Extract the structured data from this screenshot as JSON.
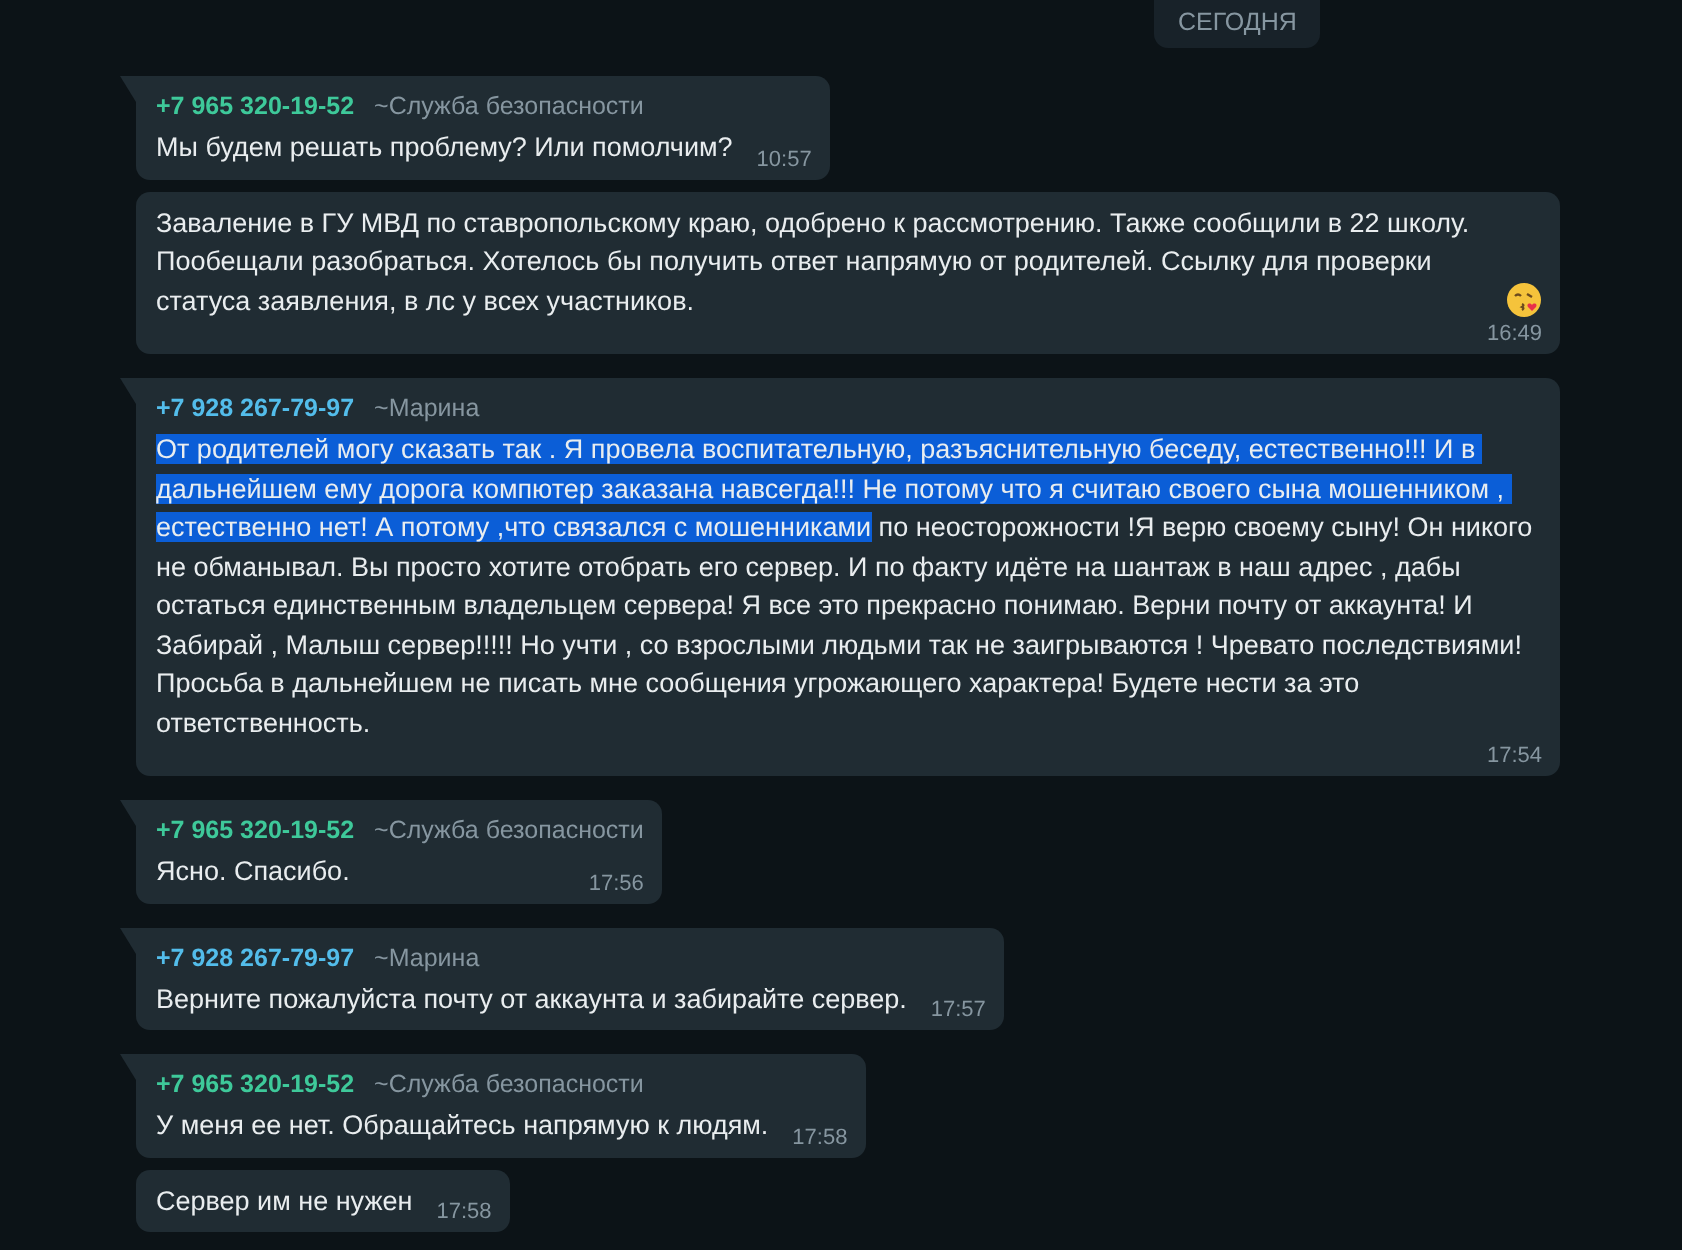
{
  "date_label": "СЕГОДНЯ",
  "messages": [
    {
      "tail": true,
      "sender": {
        "phone": "+7 965 320-19-52",
        "name": "~Служба безопасности",
        "color": "#3ec99a"
      },
      "segments": [
        {
          "text": "Мы будем решать проблему? Или помолчим?",
          "selected": false
        }
      ],
      "time": "10:57"
    },
    {
      "tail": false,
      "segments": [
        {
          "text": "Заваление в ГУ МВД по ставропольскому краю, одобрено к рассмотрению. Также сообщили в 22 школу. Пообещали разобраться. Хотелось бы получить ответ напрямую от родителей. Ссылку для проверки статуса заявления, в лс у всех участников. ",
          "selected": false
        }
      ],
      "emoji": true,
      "time": "16:49"
    },
    {
      "tail": true,
      "sender": {
        "phone": "+7 928 267-79-97",
        "name": "~Марина",
        "color": "#53bdeb"
      },
      "segments": [
        {
          "text": "От родителей могу сказать так . Я провела воспитательную, разъяснительную беседу, естественно!!! И в дальнейшем ему дорога компютер заказана навсегда!!! Не потому что я считаю своего сына мошенником , естественно нет! А потому ,что связался с мошенниками",
          "selected": true
        },
        {
          "text": " по неосторожности !Я верю своему сыну! Он никого не обманывал. Вы просто хотите отобрать его сервер. И по факту идёте на шантаж в наш адрес , дабы остаться единственным владельцем сервера! Я все это прекрасно понимаю. Верни почту от аккаунта! И  Забирай , Малыш сервер!!!!! Но учти , со взрослыми людьми так не заигрываются ! Чревато последствиями!\nПросьба в дальнейшем не писать мне сообщения угрожающего характера! Будете нести за это ответственность.",
          "selected": false
        }
      ],
      "time": "17:54"
    },
    {
      "tail": true,
      "sender": {
        "phone": "+7 965 320-19-52",
        "name": "~Служба безопасности",
        "color": "#3ec99a"
      },
      "segments": [
        {
          "text": "Ясно. Спасибо.",
          "selected": false
        }
      ],
      "time": "17:56"
    },
    {
      "tail": true,
      "sender": {
        "phone": "+7 928 267-79-97",
        "name": "~Марина",
        "color": "#53bdeb"
      },
      "segments": [
        {
          "text": "Верните пожалуйста почту от аккаунта и забирайте сервер.",
          "selected": false
        }
      ],
      "time": "17:57"
    },
    {
      "tail": true,
      "sender": {
        "phone": "+7 965 320-19-52",
        "name": "~Служба безопасности",
        "color": "#3ec99a"
      },
      "segments": [
        {
          "text": "У меня ее нет. Обращайтесь напрямую к людям.",
          "selected": false
        }
      ],
      "time": "17:58"
    },
    {
      "tail": false,
      "segments": [
        {
          "text": "Сервер им не нужен",
          "selected": false
        }
      ],
      "time": "17:58"
    }
  ]
}
